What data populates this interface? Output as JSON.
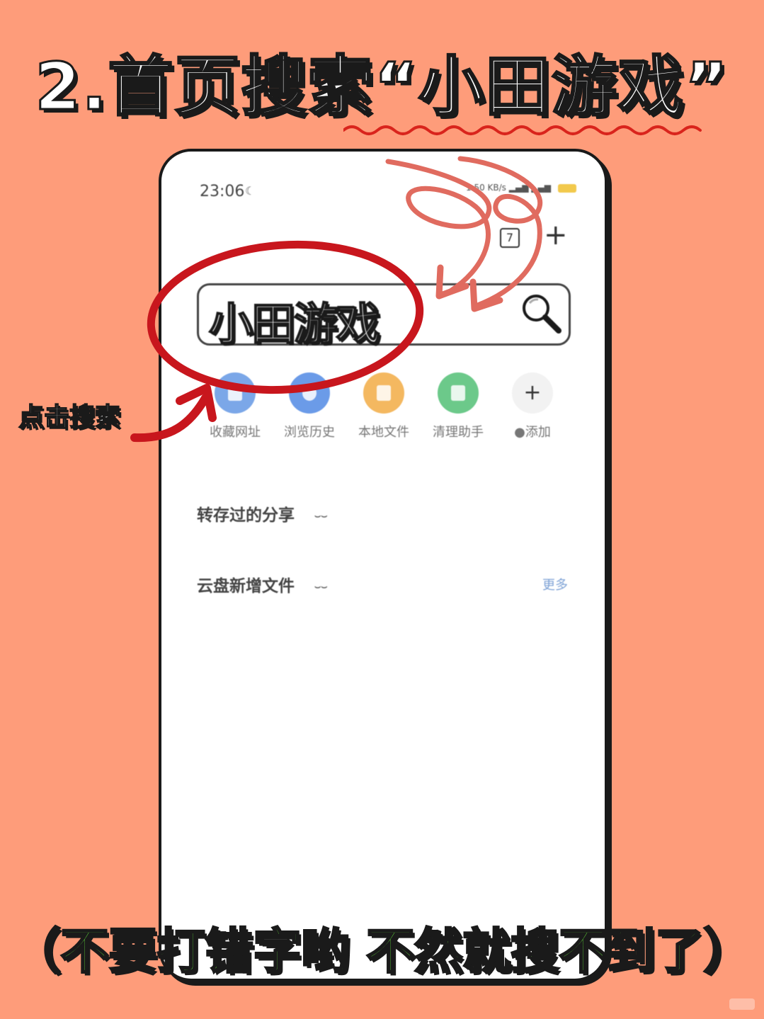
{
  "title": "2.首页搜索“小田游戏”",
  "annotation": "点击搜索",
  "bottom_note": "（不要打错字哟 不然就搜不到了）",
  "colors": {
    "background": "#FE9C7A",
    "highlight_circle": "#C8161D",
    "arrows": "#E06B5F",
    "note_green": "#5FD83A"
  },
  "phone": {
    "status_bar": {
      "time": "23:06",
      "moon_icon": "moon-icon",
      "right": "1.50 KB/s"
    },
    "tab_count": "7",
    "new_tab_icon": "+",
    "search": {
      "value": "小田游戏",
      "icon": "magnifier-icon"
    },
    "shortcuts": [
      {
        "label": "收藏网址",
        "icon": "bookmark-icon",
        "color": "#7BA7E8"
      },
      {
        "label": "浏览历史",
        "icon": "history-icon",
        "color": "#6B9BE8"
      },
      {
        "label": "本地文件",
        "icon": "folder-icon",
        "color": "#F4B860"
      },
      {
        "label": "清理助手",
        "icon": "broom-icon",
        "color": "#6CC98A"
      },
      {
        "label": "●添加",
        "icon": "plus-icon",
        "symbol": "+",
        "color": "#F2F2F2"
      }
    ],
    "sections": [
      {
        "label": "转存过的分享"
      },
      {
        "label": "云盘新增文件",
        "more": "更多"
      }
    ]
  }
}
